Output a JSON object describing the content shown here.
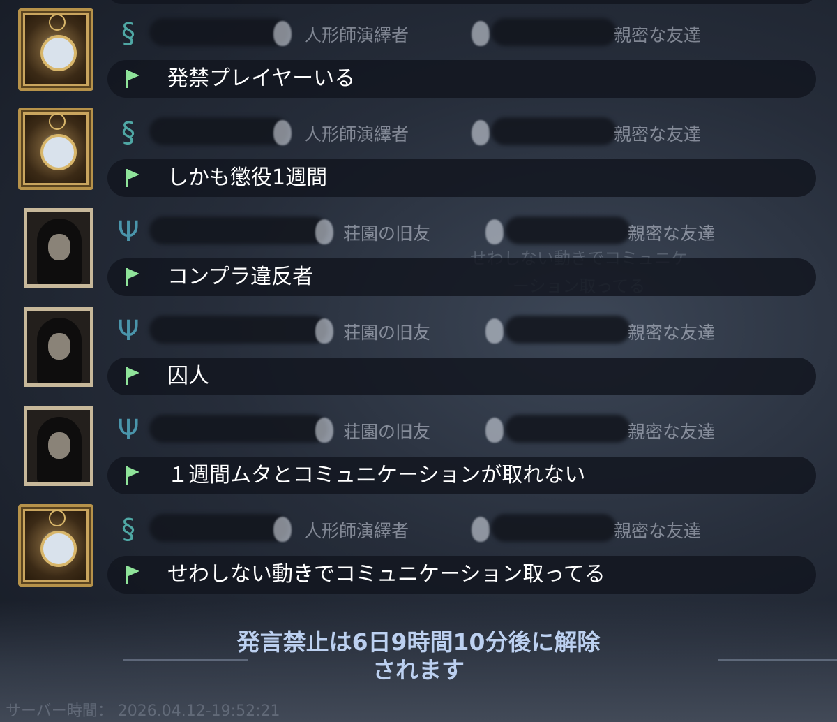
{
  "background": {
    "ghost_text_line1": "せわしない動きでコミュニケ",
    "ghost_text_line2": "ーション取ってる"
  },
  "messages": [
    {
      "avatar_icon": "gold-mirror-frame-icon",
      "badge_icon": "s-emblem-icon",
      "title": "人形師演繹者",
      "relation": "親密な友達",
      "text": "発禁プレイヤーいる"
    },
    {
      "avatar_icon": "gold-mirror-frame-icon",
      "badge_icon": "s-emblem-icon",
      "title": "人形師演繹者",
      "relation": "親密な友達",
      "text": "しかも懲役1週間"
    },
    {
      "avatar_icon": "hooded-prisoner-icon",
      "badge_icon": "deer-emblem-icon",
      "title": "荘園の旧友",
      "relation": "親密な友達",
      "text": "コンプラ違反者"
    },
    {
      "avatar_icon": "hooded-prisoner-icon",
      "badge_icon": "deer-emblem-icon",
      "title": "荘園の旧友",
      "relation": "親密な友達",
      "text": "囚人"
    },
    {
      "avatar_icon": "hooded-prisoner-icon",
      "badge_icon": "deer-emblem-icon",
      "title": "荘園の旧友",
      "relation": "親密な友達",
      "text": "１週間ムタとコミュニケーションが取れない"
    },
    {
      "avatar_icon": "gold-mirror-frame-icon",
      "badge_icon": "s-emblem-icon",
      "title": "人形師演繹者",
      "relation": "親密な友達",
      "text": "せわしない動きでコミュニケーション取ってる"
    }
  ],
  "ban_notice": {
    "line1": "発言禁止は6日9時間10分後に解除",
    "line2": "されます"
  },
  "footer": {
    "server_time_label": "サーバー時間：",
    "server_time_value": "2026.04.12-19:52:21"
  },
  "colors": {
    "flag": "#8fe39a",
    "ban_notice": "#bcd0f0",
    "message_text": "#ffffff"
  }
}
